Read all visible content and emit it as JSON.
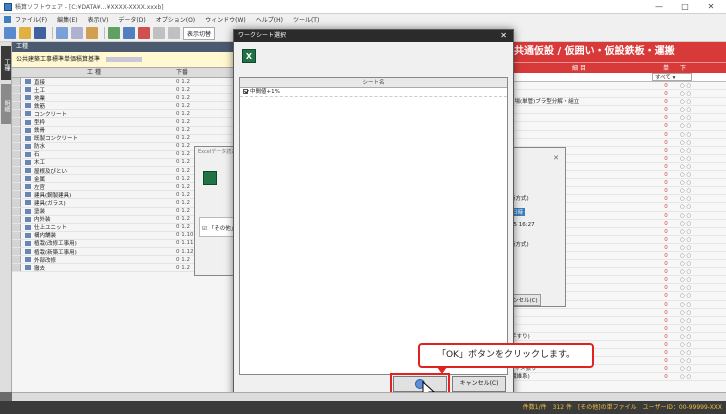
{
  "window": {
    "title": "積算ソフトウェア - [C:¥DATA¥…¥XXXX-XXXX.xxxb]",
    "min": "—",
    "max": "□",
    "close": "✕"
  },
  "menu": [
    "ファイル(F)",
    "編集(E)",
    "表示(V)",
    "データ(D)",
    "オプション(O)",
    "ウィンドウ(W)",
    "ヘルプ(H)",
    "ツール(T)"
  ],
  "toolbar": {
    "mode_label": "表示切替"
  },
  "vtabs": [
    "工種",
    "明細"
  ],
  "left_pane": {
    "head1": "工種",
    "head2": "公共建築工事標準単価積算基準",
    "col_name": "工 種",
    "col_code": "下番",
    "rows": [
      {
        "name": "直接",
        "code": "0 1.2"
      },
      {
        "name": "土工",
        "code": "0 1.2"
      },
      {
        "name": "地業",
        "code": "0 1.2"
      },
      {
        "name": "鉄筋",
        "code": "0 1.2"
      },
      {
        "name": "コンクリート",
        "code": "0 1.2"
      },
      {
        "name": "型枠",
        "code": "0 1.2"
      },
      {
        "name": "鉄骨",
        "code": "0 1.2"
      },
      {
        "name": "既製コンクリート",
        "code": "0 1.2"
      },
      {
        "name": "防水",
        "code": "0 1.2"
      },
      {
        "name": "石",
        "code": "0 1.2"
      },
      {
        "name": "木工",
        "code": "0 1.2"
      },
      {
        "name": "屋根及びとい",
        "code": "0 1.2"
      },
      {
        "name": "金属",
        "code": "0 1.2"
      },
      {
        "name": "左官",
        "code": "0 1.2"
      },
      {
        "name": "建具(鋼製建具)",
        "code": "0 1.2"
      },
      {
        "name": "建具(ガラス)",
        "code": "0 1.2"
      },
      {
        "name": "塗装",
        "code": "0 1.2"
      },
      {
        "name": "内外装",
        "code": "0 1.2"
      },
      {
        "name": "仕上ユニット",
        "code": "0 1.2"
      },
      {
        "name": "構内舗装",
        "code": "0 1.10"
      },
      {
        "name": "植栽(改修工事用)",
        "code": "0 1.11"
      },
      {
        "name": "植栽(新築工事用)",
        "code": "0 1.12"
      },
      {
        "name": "外部改修",
        "code": "0 1.2"
      },
      {
        "name": "撤去",
        "code": "0 1.2"
      }
    ]
  },
  "right_pane": {
    "title": "共通仮設 / 仮囲い・仮設鉄板・運搬",
    "col_name": "細 目",
    "col_price": "単",
    "col_flag": "下",
    "filter_all": "すべて",
    "rows": [
      {
        "name": "",
        "price": "0",
        "flag": "○ ○"
      },
      {
        "name": "数",
        "price": "0",
        "flag": "○ ○"
      },
      {
        "name": "足場(単管)ブラ型分解・組立",
        "price": "0",
        "flag": "○ ○"
      },
      {
        "name": "",
        "price": "0",
        "flag": "○ ○"
      },
      {
        "name": "",
        "price": "0",
        "flag": "○ ○"
      },
      {
        "name": "",
        "price": "0",
        "flag": "○ ○"
      },
      {
        "name": "",
        "price": "0",
        "flag": "○ ○"
      },
      {
        "name": "",
        "price": "0",
        "flag": "○ ○"
      },
      {
        "name": "",
        "price": "0",
        "flag": "○ ○"
      },
      {
        "name": "",
        "price": "0",
        "flag": "○ ○"
      },
      {
        "name": "",
        "price": "0",
        "flag": "○ ○"
      },
      {
        "name": "",
        "price": "0",
        "flag": "○ ○"
      },
      {
        "name": "",
        "price": "0",
        "flag": "○ ○"
      },
      {
        "name": "",
        "price": "0",
        "flag": "○ ○"
      },
      {
        "name": "",
        "price": "0",
        "flag": "○ ○"
      },
      {
        "name": "",
        "price": "0",
        "flag": "○ ○"
      },
      {
        "name": "",
        "price": "0",
        "flag": "○ ○"
      },
      {
        "name": "",
        "price": "0",
        "flag": "○ ○"
      },
      {
        "name": "",
        "price": "0",
        "flag": "○ ○"
      },
      {
        "name": "",
        "price": "0",
        "flag": "○ ○"
      },
      {
        "name": "",
        "price": "0",
        "flag": "○ ○"
      },
      {
        "name": "",
        "price": "0",
        "flag": "○ ○"
      },
      {
        "name": "足場",
        "price": "0",
        "flag": "○ ○"
      },
      {
        "name": "足場(手すり先行方式)",
        "price": "0",
        "flag": "○ ○"
      },
      {
        "name": "足場(手すり先行方式)",
        "price": "0",
        "flag": "○ ○"
      },
      {
        "name": "足場(枠組式)",
        "price": "0",
        "flag": "○ ○"
      },
      {
        "name": "仕上足場",
        "price": "0",
        "flag": "○ ○"
      },
      {
        "name": "場",
        "price": "0",
        "flag": "○ ○"
      },
      {
        "name": "",
        "price": "0",
        "flag": "○ ○"
      },
      {
        "name": "",
        "price": "0",
        "flag": "○ ○"
      },
      {
        "name": "",
        "price": "0",
        "flag": "○ ○"
      },
      {
        "name": "(手すり)",
        "price": "0",
        "flag": "○ ○"
      },
      {
        "name": "",
        "price": "0",
        "flag": "○ ○"
      },
      {
        "name": "",
        "price": "0",
        "flag": "○ ○"
      },
      {
        "name": "張り",
        "price": "0",
        "flag": "○ ○"
      },
      {
        "name": "キャメ張り",
        "price": "0",
        "flag": "○ ○"
      },
      {
        "name": "(繊維系)",
        "price": "0",
        "flag": "○ ○"
      }
    ]
  },
  "bg_dialog": {
    "title": "Excelデータ読込",
    "check_text": "「その他」"
  },
  "mid_dialog": {
    "close": "✕",
    "method1": "行方式)",
    "date_label": "日時",
    "date": "25 16:27",
    "method2": "行方式)",
    "cancel": "ンセル(C)"
  },
  "dialog": {
    "title": "ワークシート選択",
    "close": "✕",
    "excel_icon": "X",
    "list_header": "シート名",
    "items": [
      "中間値+1%"
    ],
    "ok": "OK",
    "cancel": "キャンセル(C)"
  },
  "callout": "「OK」ボタンをクリックします。",
  "status": "件数1/件　312 件　[その他]の単ファイル　ユーザーID：00-99999-XXX"
}
